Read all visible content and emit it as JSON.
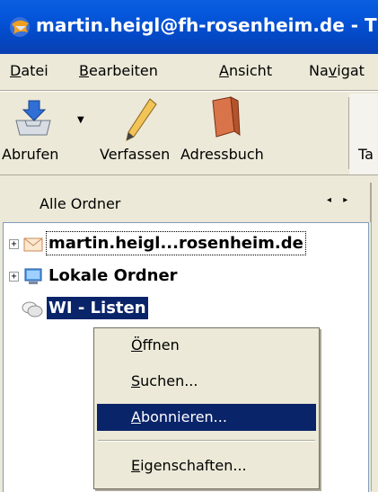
{
  "window": {
    "title": "martin.heigl@fh-rosenheim.de - T",
    "icon": "thunderbird-icon"
  },
  "menubar": {
    "items": [
      {
        "first": "D",
        "rest": "atei"
      },
      {
        "first": "B",
        "rest": "earbeiten"
      },
      {
        "first": "A",
        "rest": "nsicht"
      },
      {
        "pre": "Na",
        "ul": "v",
        "rest": "igat"
      }
    ]
  },
  "toolbar": {
    "fetch_label": "Abrufen",
    "compose_label": "Verfassen",
    "addressbook_label": "Adressbuch",
    "cut_label": "Ta"
  },
  "folder_pane": {
    "header": "Alle Ordner",
    "arrows": "◂ ▸",
    "items": [
      {
        "label": "martin.heigl...rosenheim.de",
        "icon": "mail-account-icon",
        "expander": "+"
      },
      {
        "label": "Lokale Ordner",
        "icon": "computer-icon",
        "expander": "+"
      },
      {
        "label": "WI - Listen",
        "icon": "newsgroup-icon"
      }
    ]
  },
  "context_menu": {
    "items": [
      {
        "ul": "Ö",
        "rest": "ffnen"
      },
      {
        "ul": "S",
        "rest": "uchen..."
      },
      {
        "ul": "A",
        "rest": "bonnieren..."
      },
      {
        "ul": "E",
        "rest": "igenschaften..."
      }
    ],
    "highlighted_index": 2
  },
  "colors": {
    "titlebar": "#0454d8",
    "selection": "#0a246a",
    "chrome": "#ece9d8"
  }
}
